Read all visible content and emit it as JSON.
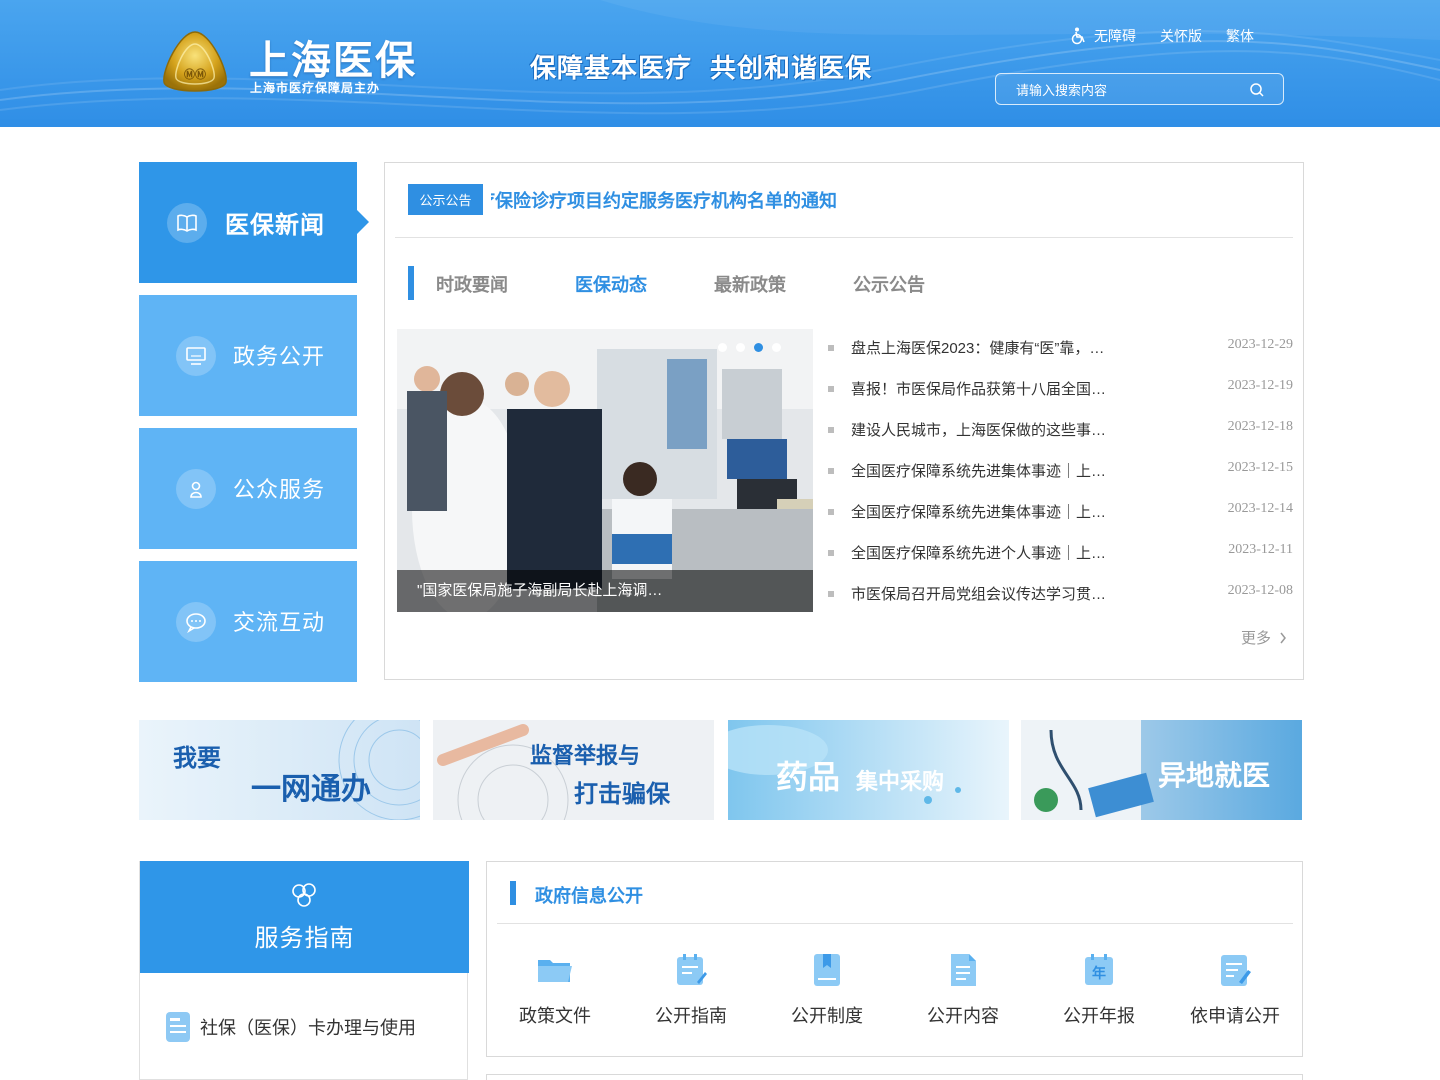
{
  "header": {
    "site_title": "上海医保",
    "site_subtitle": "上海市医疗保障局主办",
    "slogan_1": "保障基本医疗",
    "slogan_2": "共创和谐医保",
    "links": {
      "accessibility": "无障碍",
      "care_mode": "关怀版",
      "traditional": "繁体"
    },
    "search_placeholder": "请输入搜索内容",
    "emblem_text": "医疗保障"
  },
  "sidebar": {
    "items": [
      {
        "label": "医保新闻",
        "icon": "book-icon",
        "active": true
      },
      {
        "label": "政务公开",
        "icon": "monitor-icon",
        "active": false
      },
      {
        "label": "公众服务",
        "icon": "person-icon",
        "active": false
      },
      {
        "label": "交流互动",
        "icon": "chat-icon",
        "active": false
      }
    ]
  },
  "news": {
    "notice_tag": "公示公告",
    "notice_text": "疗保险诊疗项目约定服务医疗机构名单的通知",
    "tabs": [
      "时政要闻",
      "医保动态",
      "最新政策",
      "公示公告"
    ],
    "active_tab": 1,
    "carousel_caption": "\"国家医保局施子海副局长赴上海调…",
    "carousel_active_slide": 3,
    "carousel_slide_count": 4,
    "items": [
      {
        "title": "盘点上海医保2023：健康有“医”靠，…",
        "date": "2023-12-29"
      },
      {
        "title": "喜报！市医保局作品获第十八届全国…",
        "date": "2023-12-19"
      },
      {
        "title": "建设人民城市，上海医保做的这些事…",
        "date": "2023-12-18"
      },
      {
        "title": "全国医疗保障系统先进集体事迹｜上…",
        "date": "2023-12-15"
      },
      {
        "title": "全国医疗保障系统先进集体事迹｜上…",
        "date": "2023-12-14"
      },
      {
        "title": "全国医疗保障系统先进个人事迹｜上…",
        "date": "2023-12-11"
      },
      {
        "title": "市医保局召开局党组会议传达学习贯…",
        "date": "2023-12-08"
      }
    ],
    "more_label": "更多"
  },
  "banners": [
    {
      "line1": "我要",
      "line2": "一网通办"
    },
    {
      "line1": "监督举报与",
      "line2": "打击骗保",
      "sub": "骗保"
    },
    {
      "line1": "药品",
      "line2": "集中采购"
    },
    {
      "line1": "异地就医"
    }
  ],
  "guide": {
    "title": "服务指南",
    "item": "社保（医保）卡办理与使用"
  },
  "gov": {
    "title": "政府信息公开",
    "items": [
      {
        "label": "政策文件",
        "icon": "folder-icon"
      },
      {
        "label": "公开指南",
        "icon": "calendar-edit-icon"
      },
      {
        "label": "公开制度",
        "icon": "bookmark-icon"
      },
      {
        "label": "公开内容",
        "icon": "document-icon"
      },
      {
        "label": "公开年报",
        "icon": "year-calendar-icon",
        "glyph": "年"
      },
      {
        "label": "依申请公开",
        "icon": "apply-edit-icon"
      }
    ]
  },
  "colors": {
    "primary": "#2f8fe2",
    "nav_light": "#5fb4f5",
    "header_bg": "#3d9aea"
  }
}
